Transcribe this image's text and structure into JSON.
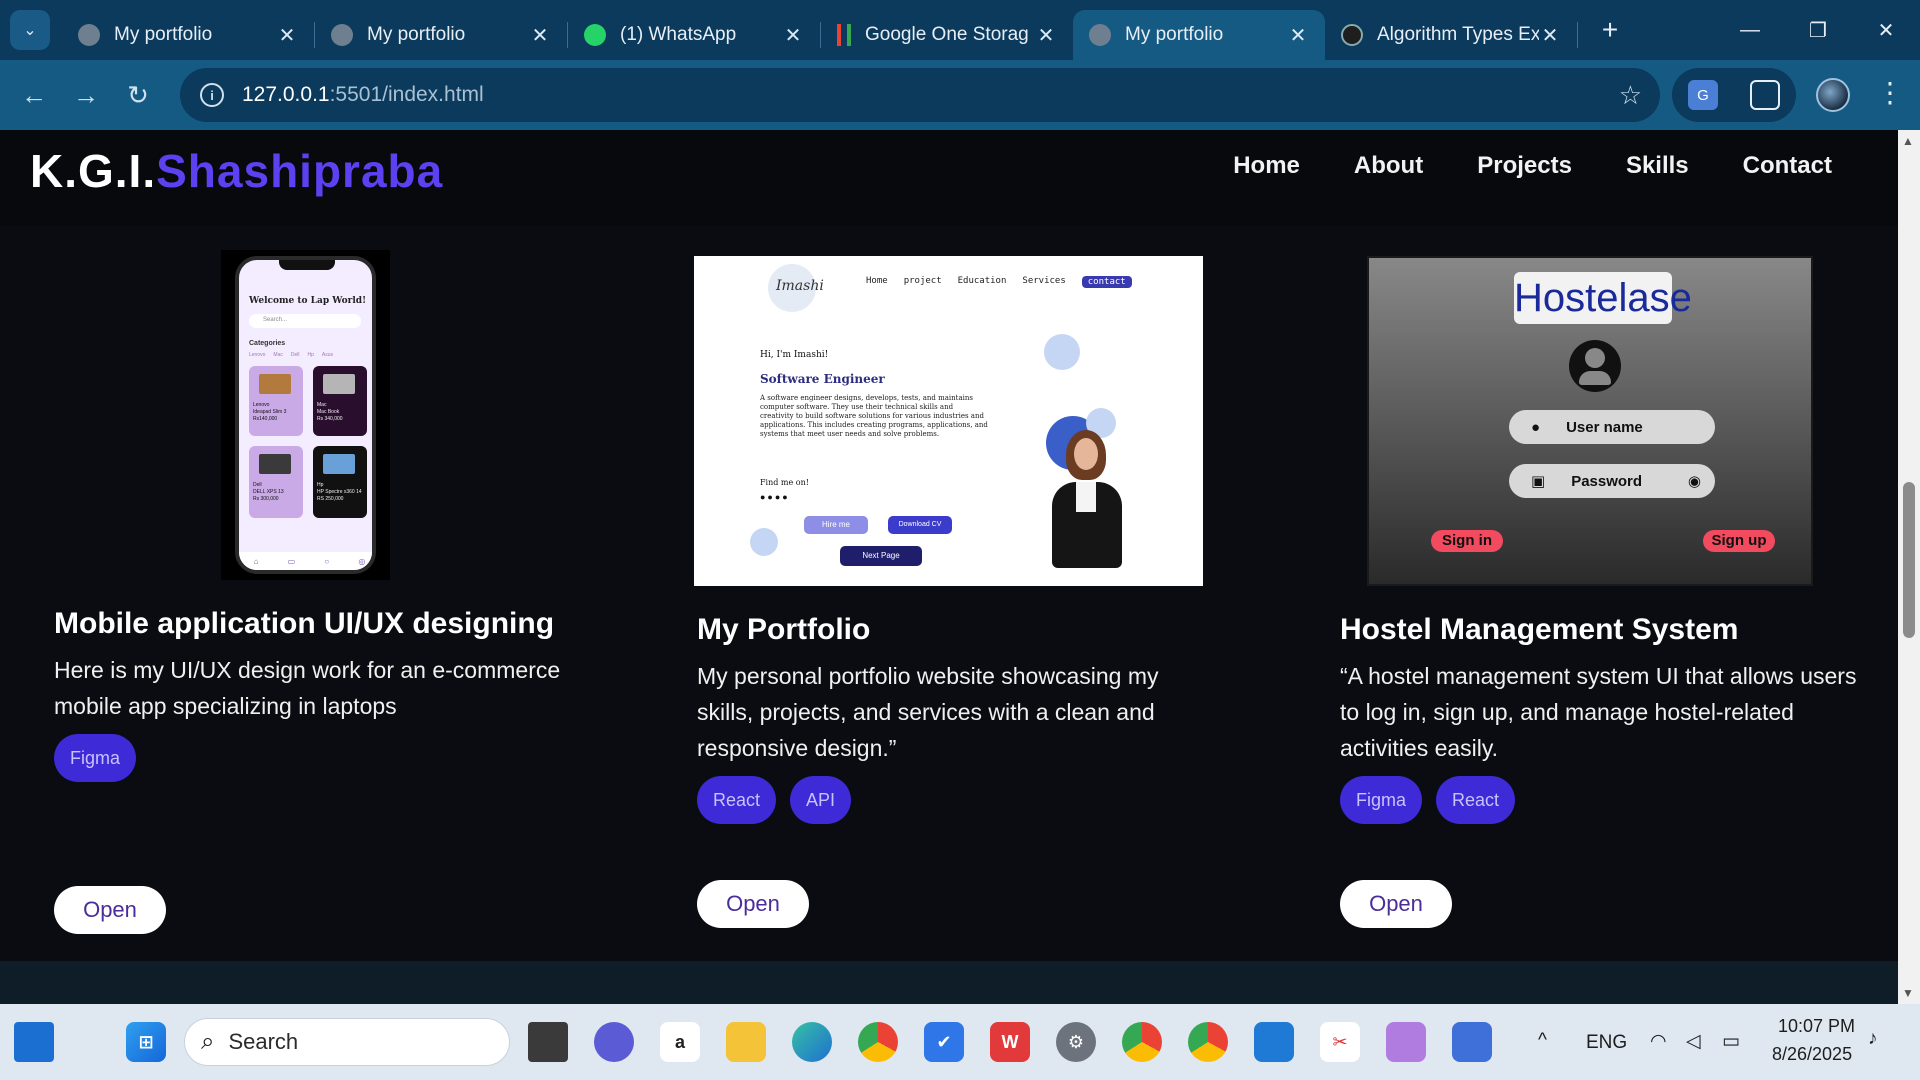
{
  "browser": {
    "tabs": [
      {
        "title": "My portfolio",
        "active": false
      },
      {
        "title": "My portfolio",
        "active": false
      },
      {
        "title": "(1) WhatsApp",
        "active": false
      },
      {
        "title": "Google One Storag",
        "active": false
      },
      {
        "title": "My portfolio",
        "active": true
      },
      {
        "title": "Algorithm Types Ex",
        "active": false
      }
    ],
    "url_host": "127.0.0.1",
    "url_rest": ":5501/index.html"
  },
  "site": {
    "logo_first": "K.G.I.",
    "logo_accent": "Shashipraba",
    "nav": [
      "Home",
      "About",
      "Projects",
      "Skills",
      "Contact"
    ]
  },
  "projects": [
    {
      "title": "Mobile application UI/UX designing",
      "description": "Here is my UI/UX design work for an e-commerce mobile app specializing in laptops",
      "tags": [
        "Figma"
      ],
      "button": "Open"
    },
    {
      "title": "My Portfolio",
      "description": "My personal portfolio website showcasing my skills, projects, and services with a clean and responsive design.”",
      "tags": [
        "React",
        "API"
      ],
      "button": "Open"
    },
    {
      "title": "Hostel Management System",
      "description": "“A hostel management system UI that allows users to log in, sign up, and manage hostel-related activities easily.",
      "tags": [
        "Figma",
        "React"
      ],
      "button": "Open"
    }
  ],
  "mockups": {
    "phone": {
      "heading": "Welcome to Lap World!",
      "search": "Search...",
      "categories_label": "Categories",
      "categories": [
        "Lenovo",
        "Mac",
        "Dell",
        "Hp",
        "Asus"
      ],
      "items": [
        {
          "brand": "Lenovo",
          "model": "Ideapad Slim 3",
          "price": "Rs140,000"
        },
        {
          "brand": "Mac",
          "model": "Mac Book",
          "price": "Rs 340,000"
        },
        {
          "brand": "Dell",
          "model": "DELL XPS 13",
          "price": "Rs 300,000"
        },
        {
          "brand": "Hp",
          "model": "HP Spectre x360 14",
          "price": "RS 250,000"
        }
      ]
    },
    "portfolio": {
      "logo": "Imashi",
      "nav": [
        "Home",
        "project",
        "Education",
        "Services",
        "contact"
      ],
      "greeting": "Hi, I'm Imashi!",
      "role": "Software Engineer",
      "blurb": "A software engineer designs, develops, tests, and maintains computer software. They use their technical skills and creativity to build software solutions for various industries and applications. This includes creating programs, applications, and systems that meet user needs and solve problems.",
      "find_me": "Find me on!",
      "btn_hire": "Hire me",
      "btn_cv": "Download CV",
      "btn_next": "Next Page"
    },
    "hostel": {
      "title": "Hostelase",
      "username": "User name",
      "password": "Password",
      "sign_in": "Sign in",
      "sign_up": "Sign up"
    }
  },
  "taskbar": {
    "search": "Search",
    "lang": "ENG",
    "time": "10:07 PM",
    "date": "8/26/2025"
  },
  "colors": {
    "accent": "#5a42f0",
    "tag_bg": "#3e2ad6",
    "browser_frame": "#0b3a5c",
    "toolbar": "#155a82"
  }
}
